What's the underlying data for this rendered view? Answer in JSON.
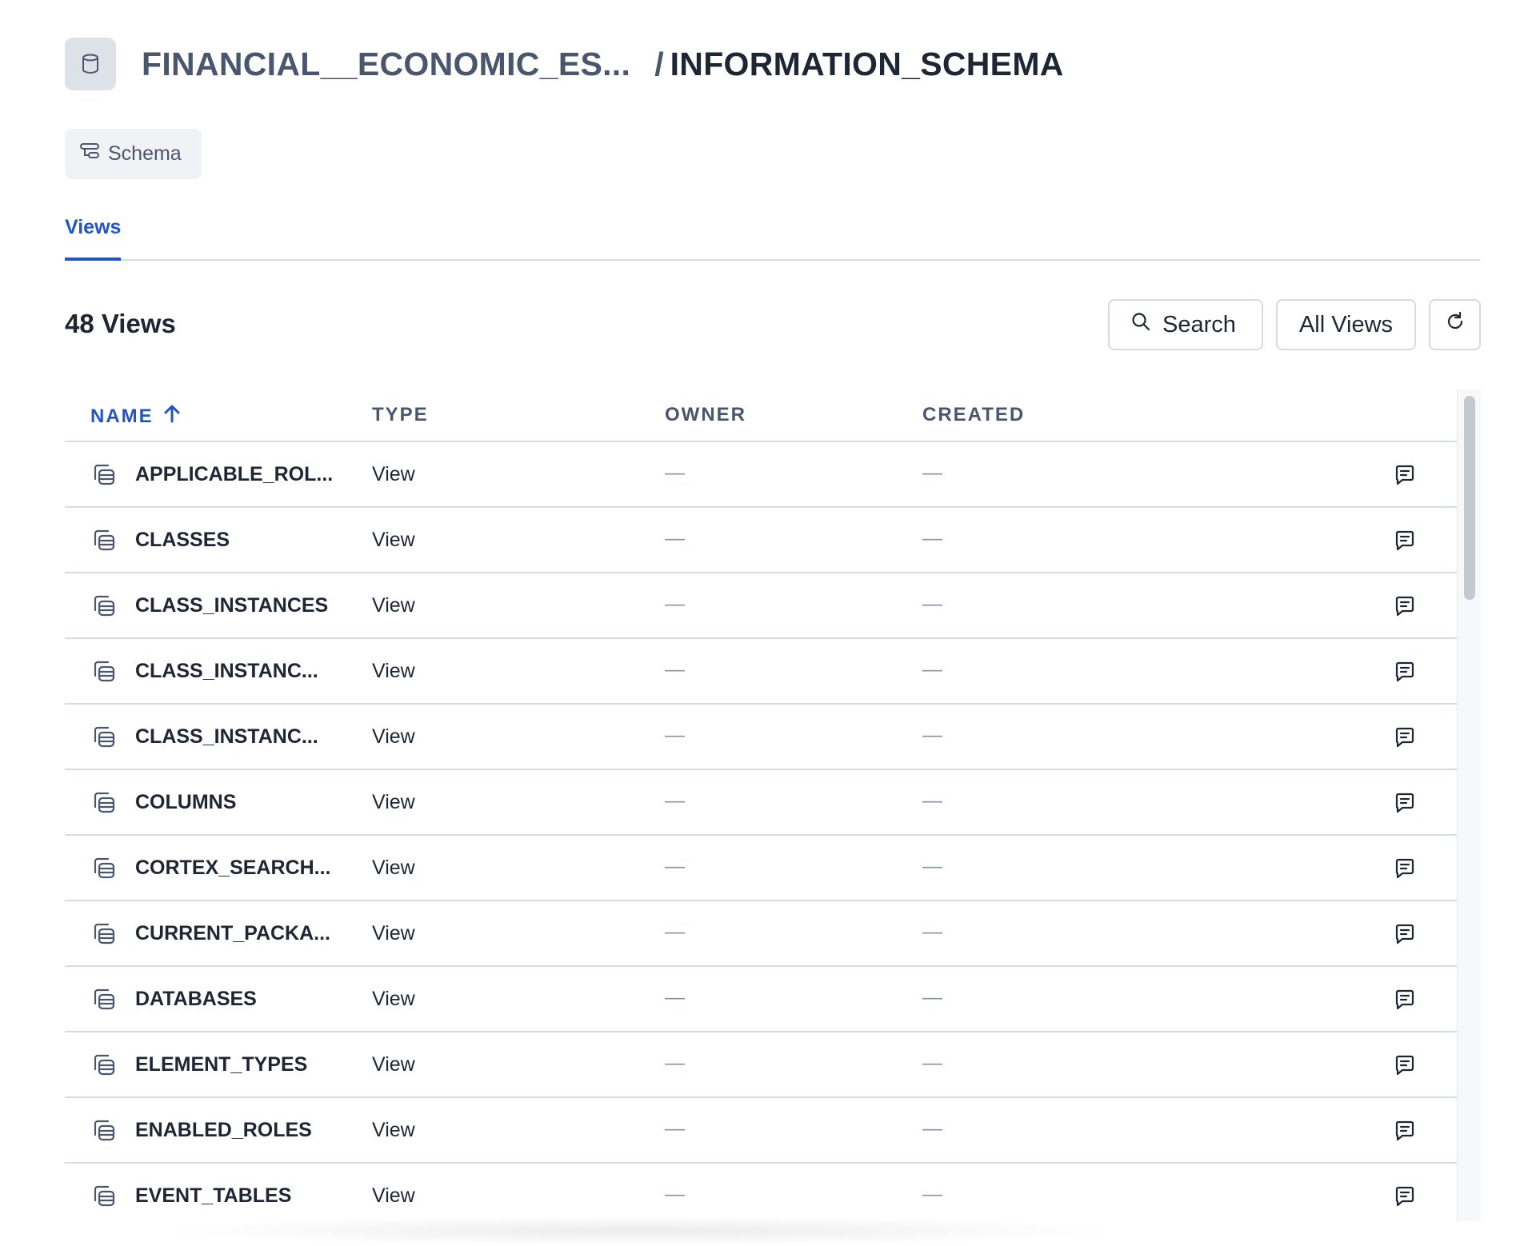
{
  "header": {
    "parent_database": "FINANCIAL__ECONOMIC_ES...",
    "separator": "/",
    "current_schema": "INFORMATION_SCHEMA"
  },
  "schema_chip": {
    "label": "Schema"
  },
  "tabs": [
    {
      "label": "Views",
      "active": true
    }
  ],
  "toolbar": {
    "count_title": "48 Views",
    "search_label": "Search",
    "filter_label": "All Views"
  },
  "table": {
    "columns": [
      "NAME",
      "TYPE",
      "OWNER",
      "CREATED"
    ],
    "sort_column": "NAME",
    "sort_direction": "ascending",
    "rows": [
      {
        "name": "APPLICABLE_ROL...",
        "type": "View",
        "owner": "—",
        "created": "—"
      },
      {
        "name": "CLASSES",
        "type": "View",
        "owner": "—",
        "created": "—"
      },
      {
        "name": "CLASS_INSTANCES",
        "type": "View",
        "owner": "—",
        "created": "—"
      },
      {
        "name": "CLASS_INSTANC...",
        "type": "View",
        "owner": "—",
        "created": "—"
      },
      {
        "name": "CLASS_INSTANC...",
        "type": "View",
        "owner": "—",
        "created": "—"
      },
      {
        "name": "COLUMNS",
        "type": "View",
        "owner": "—",
        "created": "—"
      },
      {
        "name": "CORTEX_SEARCH...",
        "type": "View",
        "owner": "—",
        "created": "—"
      },
      {
        "name": "CURRENT_PACKA...",
        "type": "View",
        "owner": "—",
        "created": "—"
      },
      {
        "name": "DATABASES",
        "type": "View",
        "owner": "—",
        "created": "—"
      },
      {
        "name": "ELEMENT_TYPES",
        "type": "View",
        "owner": "—",
        "created": "—"
      },
      {
        "name": "ENABLED_ROLES",
        "type": "View",
        "owner": "—",
        "created": "—"
      },
      {
        "name": "EVENT_TABLES",
        "type": "View",
        "owner": "—",
        "created": "—"
      }
    ]
  },
  "colors": {
    "accent": "#1f55c9",
    "text_primary": "#1e2533",
    "text_secondary": "#4a566d",
    "border": "#d7dbe3"
  },
  "icons": {
    "database": "database-icon",
    "schema": "schema-icon",
    "search": "search-icon",
    "refresh": "refresh-icon",
    "sort": "arrow-up-icon",
    "view_row": "view-icon",
    "comment": "comment-icon"
  }
}
